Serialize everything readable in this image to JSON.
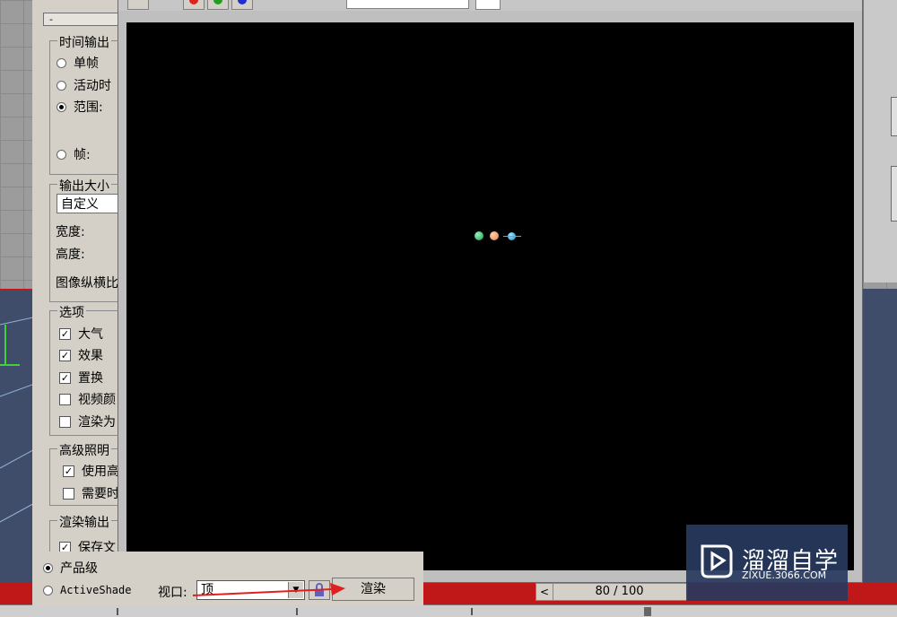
{
  "setup": {
    "rollout_toggle": "-",
    "time_output": {
      "title": "时间输出",
      "single": "单帧",
      "active": "活动时",
      "range": "范围:",
      "frames": "帧:"
    },
    "output_size": {
      "title": "输出大小",
      "preset": "自定义",
      "width": "宽度:",
      "height": "高度:",
      "aspect": "图像纵横比"
    },
    "options": {
      "title": "选项",
      "items": [
        {
          "label": "大气",
          "checked": true
        },
        {
          "label": "效果",
          "checked": true
        },
        {
          "label": "置换",
          "checked": true
        },
        {
          "label": "视频颜",
          "checked": false
        },
        {
          "label": "渲染为",
          "checked": false
        }
      ]
    },
    "advanced_lighting": {
      "title": "高级照明",
      "items": [
        {
          "label": "使用高",
          "checked": true
        },
        {
          "label": "需要时",
          "checked": false
        }
      ]
    },
    "render_output": {
      "title": "渲染输出",
      "items": [
        {
          "label": "保存文",
          "checked": true
        }
      ]
    }
  },
  "bottom": {
    "production_label": "产品级",
    "activeshade_label": "ActiveShade",
    "viewport_label": "视口:",
    "viewport_value": "顶",
    "render_button": "渲染"
  },
  "timeline": {
    "frame_display": "80 / 100",
    "prev_icon": "<"
  },
  "watermark": {
    "title": "溜溜自学",
    "url": "ZIXUE.3066.COM"
  },
  "colors": {
    "canvas": "#000000",
    "accent_red": "#c01818",
    "planet_green": "#47c07a",
    "planet_orange": "#f0a070",
    "planet_blue": "#4ab0e0"
  }
}
